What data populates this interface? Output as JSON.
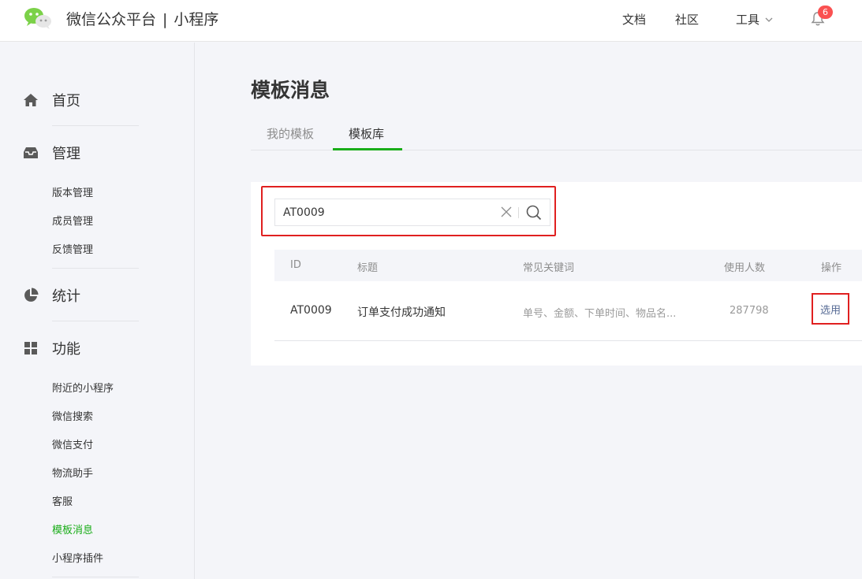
{
  "header": {
    "brand": "微信公众平台",
    "separator": "|",
    "product": "小程序",
    "nav": {
      "docs": "文档",
      "community": "社区",
      "tools": "工具"
    },
    "notification_count": "6"
  },
  "sidebar": {
    "home": "首页",
    "manage": "管理",
    "manage_items": [
      "版本管理",
      "成员管理",
      "反馈管理"
    ],
    "stats": "统计",
    "features": "功能",
    "feature_items": [
      "附近的小程序",
      "微信搜索",
      "微信支付",
      "物流助手",
      "客服",
      "模板消息",
      "小程序插件"
    ],
    "active_item": "模板消息"
  },
  "main": {
    "title": "模板消息",
    "tabs": [
      "我的模板",
      "模板库"
    ],
    "active_tab": "模板库",
    "search": {
      "value": "AT0009"
    },
    "table": {
      "columns": [
        "ID",
        "标题",
        "常见关键词",
        "使用人数",
        "操作"
      ],
      "rows": [
        {
          "id": "AT0009",
          "title": "订单支付成功通知",
          "keywords": "单号、金额、下单时间、物品名...",
          "users": "287798",
          "action": "选用"
        }
      ]
    }
  },
  "colors": {
    "accent_green": "#1aad19",
    "highlight_red": "#e02020",
    "link_blue": "#576b95",
    "badge_red": "#fa5151"
  }
}
